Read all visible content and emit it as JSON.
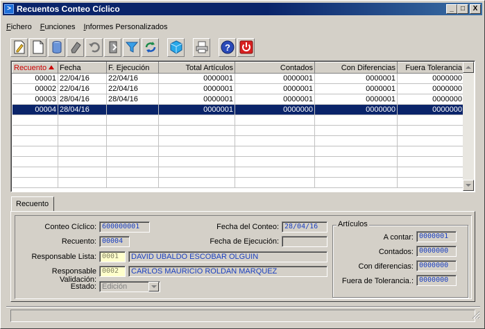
{
  "window": {
    "title": "Recuentos Conteo Cíclico",
    "controls": [
      "_",
      "□",
      "X"
    ]
  },
  "menu": [
    {
      "label": "Fichero"
    },
    {
      "label": "Funciones"
    },
    {
      "label": "Informes Personalizados"
    }
  ],
  "toolbar": {
    "buttons": [
      "new-record-icon",
      "blank-page-icon",
      "database-icon",
      "eraser-icon",
      "undo-icon",
      "exit-icon",
      "filter-icon",
      "refresh-icon",
      "cube-icon",
      "print-icon",
      "help-icon",
      "power-icon"
    ]
  },
  "grid": {
    "columns": [
      "Recuento",
      "Fecha",
      "F. Ejecución",
      "Total Artículos",
      "Contados",
      "Con Diferencias",
      "Fuera Tolerancia"
    ],
    "rows": [
      [
        "00001",
        "22/04/16",
        "22/04/16",
        "0000001",
        "0000001",
        "0000001",
        "0000000"
      ],
      [
        "00002",
        "22/04/16",
        "22/04/16",
        "0000001",
        "0000001",
        "0000001",
        "0000000"
      ],
      [
        "00003",
        "28/04/16",
        "28/04/16",
        "0000001",
        "0000001",
        "0000001",
        "0000000"
      ],
      [
        "00004",
        "28/04/16",
        "",
        "0000001",
        "0000000",
        "0000000",
        "0000000"
      ]
    ]
  },
  "tab": {
    "label": "Recuento"
  },
  "form": {
    "conteo_ciclico": {
      "label": "Conteo Cíclico:",
      "value": "600000001"
    },
    "recuento": {
      "label": "Recuento:",
      "value": "00004"
    },
    "responsable_lista": {
      "label": "Responsable Lista:",
      "code": "0001",
      "name": "DAVID UBALDO ESCOBAR OLGUIN"
    },
    "responsable_validacion": {
      "label": "Responsable Validación:",
      "code": "0002",
      "name": "CARLOS MAURICIO ROLDAN MARQUEZ"
    },
    "estado": {
      "label": "Estado:",
      "value": "Edición"
    },
    "fecha_conteo": {
      "label": "Fecha del Conteo:",
      "value": "28/04/16"
    },
    "fecha_ejecucion": {
      "label": "Fecha de Ejecución:",
      "value": ""
    }
  },
  "articulos": {
    "title": "Artículos",
    "a_contar": {
      "label": "A contar:",
      "value": "0000001"
    },
    "contados": {
      "label": "Contados:",
      "value": "0000000"
    },
    "con_diferencias": {
      "label": "Con diferencias:",
      "value": "0000000"
    },
    "fuera_tolerancia": {
      "label": "Fuera de Tolerancia.:",
      "value": "0000000"
    }
  },
  "colors": {
    "title_bar": "#0a246a",
    "selection": "#0a246a",
    "field_text": "#1a3fc0",
    "sort_marker": "#cc0000"
  }
}
